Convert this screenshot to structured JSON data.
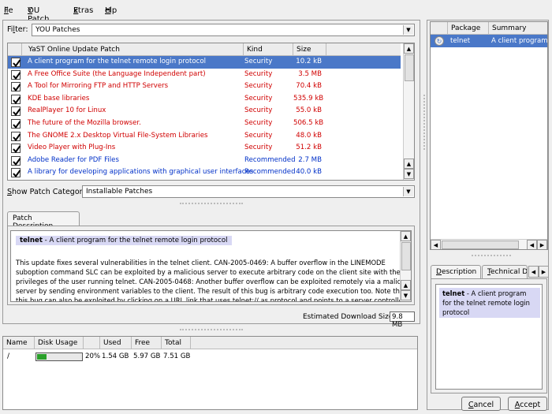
{
  "menu": [
    "File",
    "YOU Patch",
    "Extras",
    "Help"
  ],
  "filter": {
    "label": "Filter:",
    "value": "YOU Patches"
  },
  "patch_table": {
    "headers": [
      "YaST Online Update Patch",
      "Kind",
      "Size"
    ],
    "rows": [
      {
        "name": "A client program for the telnet remote login protocol",
        "kind": "Security",
        "size": "10.2 kB",
        "selected": true,
        "color": "sel"
      },
      {
        "name": "A Free Office Suite (the Language Independent part)",
        "kind": "Security",
        "size": "3.5 MB",
        "color": "red"
      },
      {
        "name": "A Tool for Mirroring FTP and HTTP Servers",
        "kind": "Security",
        "size": "70.4 kB",
        "color": "red"
      },
      {
        "name": "KDE base libraries",
        "kind": "Security",
        "size": "535.9 kB",
        "color": "red"
      },
      {
        "name": "RealPlayer 10 for Linux",
        "kind": "Security",
        "size": "55.0 kB",
        "color": "red"
      },
      {
        "name": "The future of the Mozilla browser.",
        "kind": "Security",
        "size": "506.5 kB",
        "color": "red"
      },
      {
        "name": "The GNOME 2.x Desktop Virtual File-System Libraries",
        "kind": "Security",
        "size": "48.0 kB",
        "color": "red"
      },
      {
        "name": "Video Player with Plug-Ins",
        "kind": "Security",
        "size": "51.2 kB",
        "color": "red"
      },
      {
        "name": "Adobe Reader for PDF Files",
        "kind": "Recommended",
        "size": "2.7 MB",
        "color": "blue"
      },
      {
        "name": "A library for developing applications with graphical user interfaces",
        "kind": "Recommended",
        "size": "40.0 kB",
        "color": "blue"
      }
    ]
  },
  "category": {
    "label": "Show Patch Category:",
    "value": "Installable Patches"
  },
  "description": {
    "tab": "Patch Description",
    "title_bold": "telnet",
    "title_rest": " - A client program for the telnet remote login protocol",
    "lines": [
      "This update fixes several vulnerabilities in the telnet client. CAN-2005-0469: A buffer overflow in the LINEMODE",
      "suboption command SLC can be exploited by a malicious server to execute arbitrary code on the client site with the",
      "privileges of the user running telnet. CAN-2005-0468: Another buffer overflow can be exploited remotely via a malicious",
      "server by sending environment variables to the client. The result of this bug is arbitrary code execution too. Note that",
      "this bug can also be exploited by clicking on a URL link that uses telnet:// as protocol and points to a server controlled"
    ]
  },
  "download": {
    "label": "Estimated Download Size:",
    "value": "9.8 MB"
  },
  "disk": {
    "headers": [
      "Name",
      "Disk Usage",
      "",
      "Used",
      "Free",
      "Total"
    ],
    "rows": [
      {
        "name": "/",
        "percent": "20%",
        "used": "1.54 GB",
        "free": "5.97 GB",
        "total": "7.51 GB",
        "usage": 0.2
      }
    ]
  },
  "packages": {
    "headers": [
      "Package",
      "Summary"
    ],
    "rows": [
      {
        "name": "telnet",
        "summary": "A client program fo"
      }
    ]
  },
  "right_tabs": [
    "Description",
    "Technical Da"
  ],
  "right_desc": {
    "bold": "telnet",
    "rest": " - A client program for the telnet remote login protocol"
  },
  "buttons": {
    "cancel": "Cancel",
    "accept": "Accept"
  }
}
